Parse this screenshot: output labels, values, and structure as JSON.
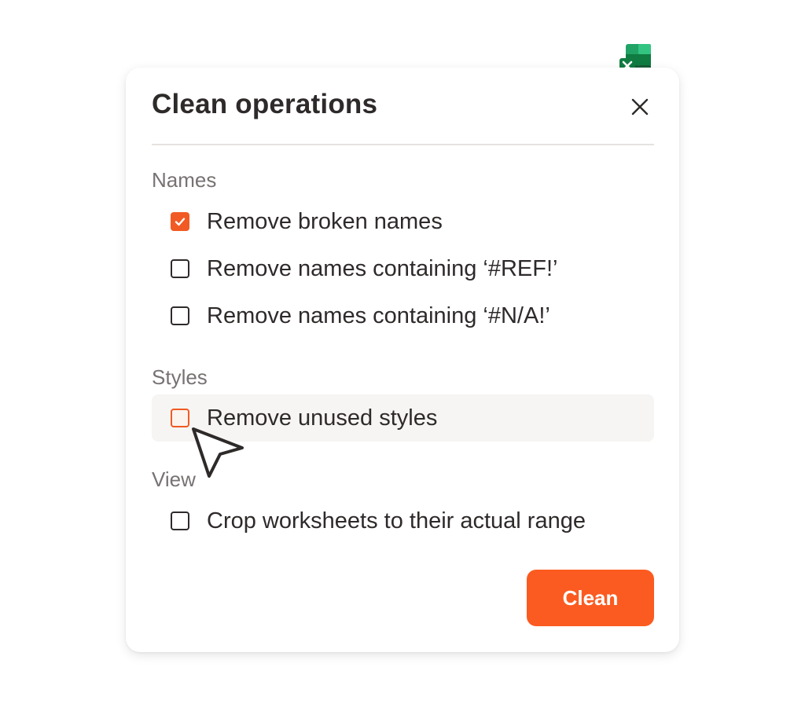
{
  "dialog": {
    "title": "Clean operations",
    "close_icon": "close-icon"
  },
  "app_icon": "excel-logo-icon",
  "sections": {
    "names": {
      "label": "Names",
      "options": [
        {
          "label": "Remove broken names",
          "checked": true
        },
        {
          "label": "Remove names containing ‘#REF!’",
          "checked": false
        },
        {
          "label": "Remove names containing ‘#N/A!’",
          "checked": false
        }
      ]
    },
    "styles": {
      "label": "Styles",
      "options": [
        {
          "label": "Remove unused styles",
          "checked": false,
          "hovered": true
        }
      ]
    },
    "view": {
      "label": "View",
      "options": [
        {
          "label": "Crop worksheets to their actual range",
          "checked": false
        }
      ]
    }
  },
  "actions": {
    "clean_label": "Clean"
  },
  "colors": {
    "accent": "#fb5b20",
    "text": "#2f2a2a",
    "muted": "#787272",
    "hover_row": "#f6f5f3"
  }
}
